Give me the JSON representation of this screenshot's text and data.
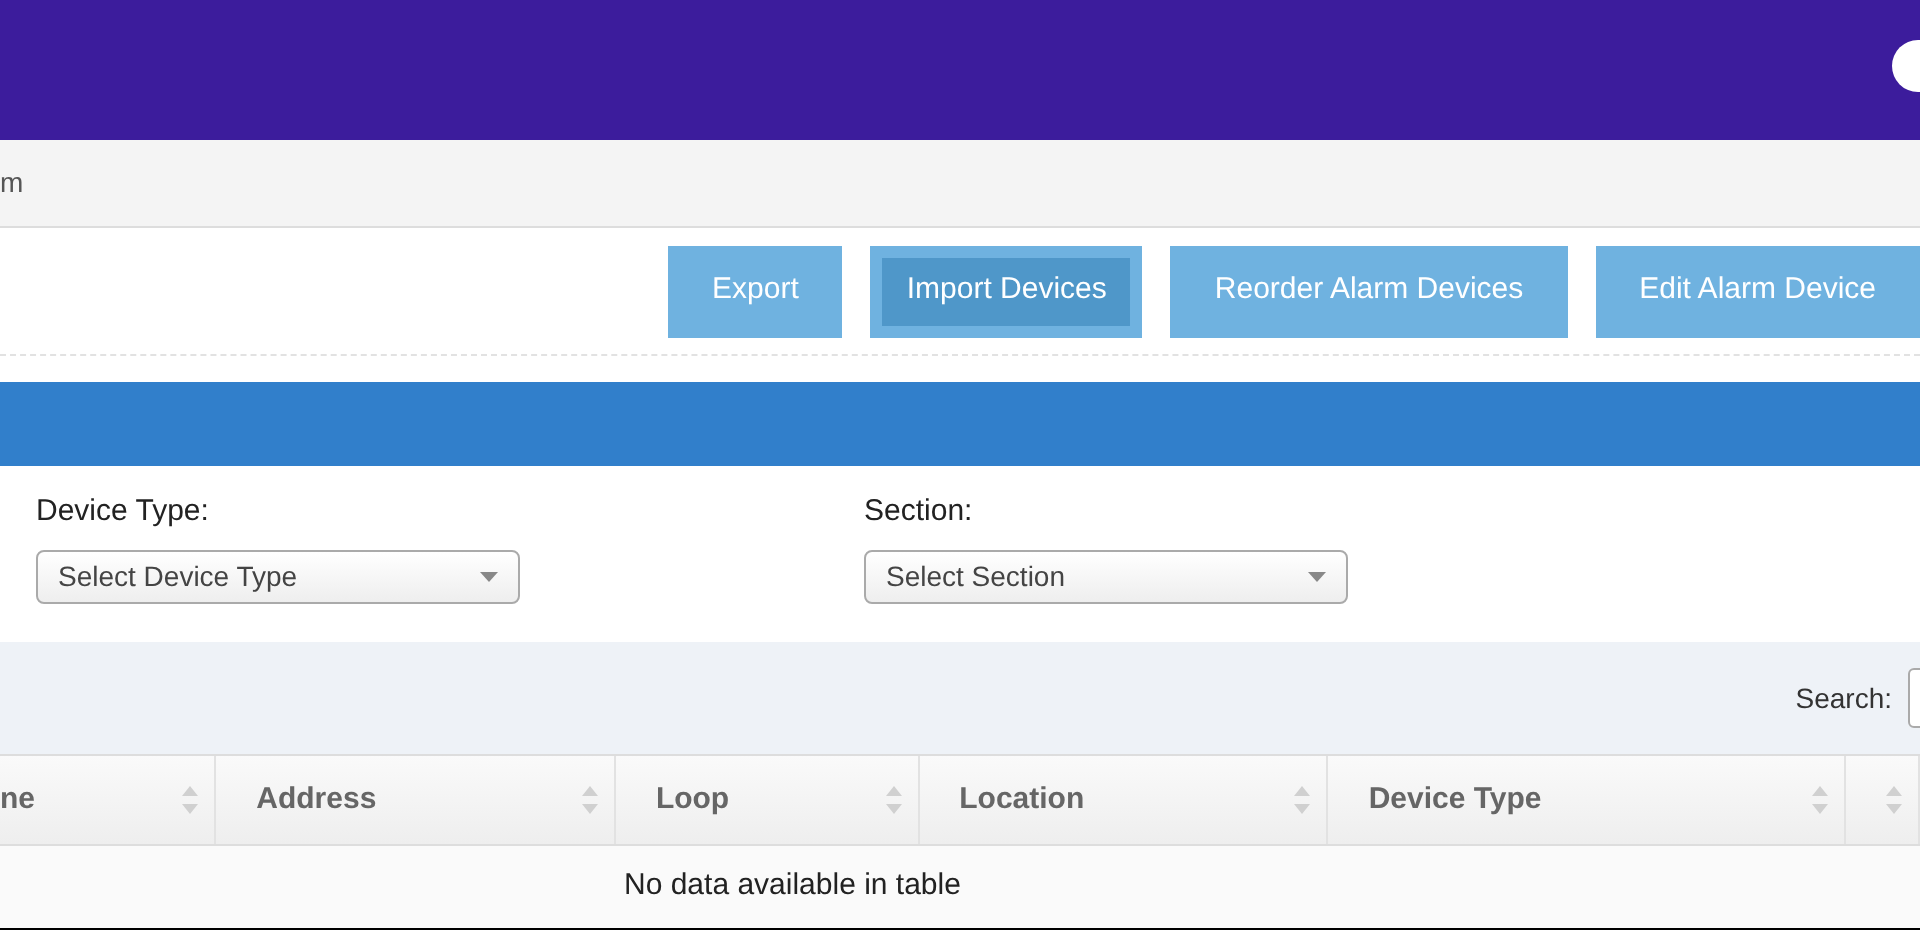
{
  "breadcrumb": "m",
  "toolbar": {
    "buttons": [
      {
        "label": "Export",
        "focused": false
      },
      {
        "label": "Import Devices",
        "focused": true
      },
      {
        "label": "Reorder Alarm Devices",
        "focused": false
      },
      {
        "label": "Edit Alarm Device",
        "focused": false
      }
    ]
  },
  "filters": [
    {
      "label": "Device Type:",
      "placeholder": "Select Device Type"
    },
    {
      "label": "Section:",
      "placeholder": "Select Section"
    }
  ],
  "search": {
    "label": "Search:"
  },
  "table": {
    "columns": [
      "ne",
      "Address",
      "Loop",
      "Location",
      "Device Type",
      ""
    ],
    "empty_message": "No data available in table"
  }
}
